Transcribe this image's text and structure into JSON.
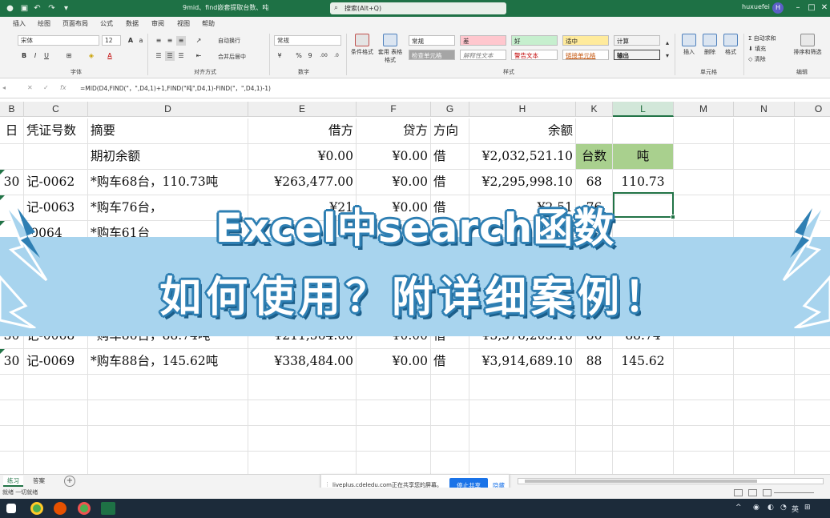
{
  "window": {
    "doc_title": "9mid、find嵌套提取台数、吨",
    "search_placeholder": "搜索(Alt+Q)",
    "user": "huxuefei",
    "avatar": "H"
  },
  "ribbon": {
    "tabs": [
      "插入",
      "绘图",
      "页面布局",
      "公式",
      "数据",
      "审阅",
      "视图",
      "帮助"
    ],
    "font_name": "宋体",
    "font_size": "12",
    "wrap_text": "自动换行",
    "merge_center": "合并后居中",
    "number_format": "常规",
    "cond_format": "条件格式",
    "table_format": "套用\n表格格式",
    "insert": "插入",
    "delete": "删除",
    "format": "格式",
    "autosum": "自动求和",
    "fill": "填充",
    "clear": "清除",
    "sort_filter": "排序和筛选",
    "groups": {
      "font": "字体",
      "align": "对齐方式",
      "number": "数字",
      "styles": "样式",
      "cells": "单元格",
      "edit": "编辑"
    },
    "styles": {
      "normal": "常规",
      "bad": "差",
      "good": "好",
      "neutral": "适中",
      "calc": "计算",
      "check_cell": "检查单元格",
      "explanatory": "解释性文本",
      "warning": "警告文本",
      "linked": "链接单元格",
      "output": "输出"
    },
    "colors": {
      "bad": "#ffc7ce",
      "good": "#c6efce",
      "neutral": "#ffeb9c",
      "calc": "#f2f2f2",
      "check": "#a5a5a5"
    }
  },
  "formula_bar": {
    "formula": "=MID(D4,FIND(\"，\",D4,1)+1,FIND(\"吨\",D4,1)-FIND(\"，\",D4,1)-1)"
  },
  "columns": [
    "B",
    "C",
    "D",
    "E",
    "F",
    "G",
    "H",
    "K",
    "L",
    "M",
    "N",
    "O"
  ],
  "rows": [
    {
      "b": "日",
      "c": "凭证号数",
      "d": "摘要",
      "e": "借方",
      "f": "贷方",
      "g": "方向",
      "h": "余额",
      "k": "",
      "l": ""
    },
    {
      "b": "",
      "c": "",
      "d": "期初余额",
      "e": "¥0.00",
      "f": "¥0.00",
      "g": "借",
      "h": "¥2,032,521.10",
      "k": "台数",
      "l": "吨"
    },
    {
      "b": "30",
      "c": "记-0062",
      "d": "*购车68台，110.73吨",
      "e": "¥263,477.00",
      "f": "¥0.00",
      "g": "借",
      "h": "¥2,295,998.10",
      "k": "68",
      "l": "110.73"
    },
    {
      "b": "",
      "c": "记-0063",
      "d": "*购车76台，",
      "e": "¥21",
      "f": "¥0.00",
      "g": "借",
      "h": "¥2,51",
      "k": "76",
      "l": ""
    },
    {
      "b": "",
      "c": "-0064",
      "d": "*购车61台",
      "e": "",
      "f": "",
      "g": "",
      "h": "",
      "k": "",
      "l": ""
    },
    {
      "b": "30",
      "c": "记-0068",
      "d": "*购车86台，88.74吨",
      "e": "¥211,564.00",
      "f": "¥0.00",
      "g": "借",
      "h": "¥3,576,205.10",
      "k": "86",
      "l": "88.74"
    },
    {
      "b": "30",
      "c": "记-0069",
      "d": "*购车88台，145.62吨",
      "e": "¥338,484.00",
      "f": "¥0.00",
      "g": "借",
      "h": "¥3,914,689.10",
      "k": "88",
      "l": "145.62"
    }
  ],
  "banner": {
    "line1": "Excel中search函数",
    "line2": "如何使用？附详细案例！",
    "strip_color": "#a8d4ee",
    "outline_color": "#2e7fb3"
  },
  "sheets": [
    "练习",
    "答案"
  ],
  "status": "就绪  一切就绪",
  "share_notice": {
    "text": "liveplus.cdeledu.com正在共享您的屏幕。",
    "stop": "停止共享",
    "hide": "隐藏"
  },
  "taskbar": {
    "lang": "英"
  }
}
